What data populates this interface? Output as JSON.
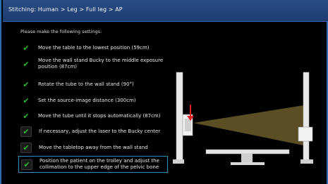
{
  "window": {
    "title": "Stitching: Human > Leg > Full leg > AP"
  },
  "instruction": "Please make the following settings:",
  "steps": [
    {
      "label": "Move the table to the lowest position (59cm)",
      "checked": true
    },
    {
      "label": "Move the wall stand Bucky to the middle exposure position (87cm)",
      "checked": true
    },
    {
      "label": "Rotate the tube to the wall stand (90°)",
      "checked": true
    },
    {
      "label": "Set the source-image distance (300cm)",
      "checked": true
    },
    {
      "label": "Move the tube until it stops automatically (87cm)",
      "checked": true
    },
    {
      "label": "If necessary, adjust the laser to the Bucky center",
      "checked": true
    },
    {
      "label": "Move the tabletop away from the wall stand",
      "checked": true
    },
    {
      "label": "Position the patient on the trolley and adjust the collimation to the upper edge of the pelvic bone",
      "checked": true
    }
  ],
  "colors": {
    "accent": "#2a6fb4",
    "check": "#2bb52b",
    "beam": "#6b5a2a",
    "arrow": "#e02020"
  },
  "icons": {
    "check": "check-mark-icon",
    "arrow": "arrow-down-icon"
  }
}
